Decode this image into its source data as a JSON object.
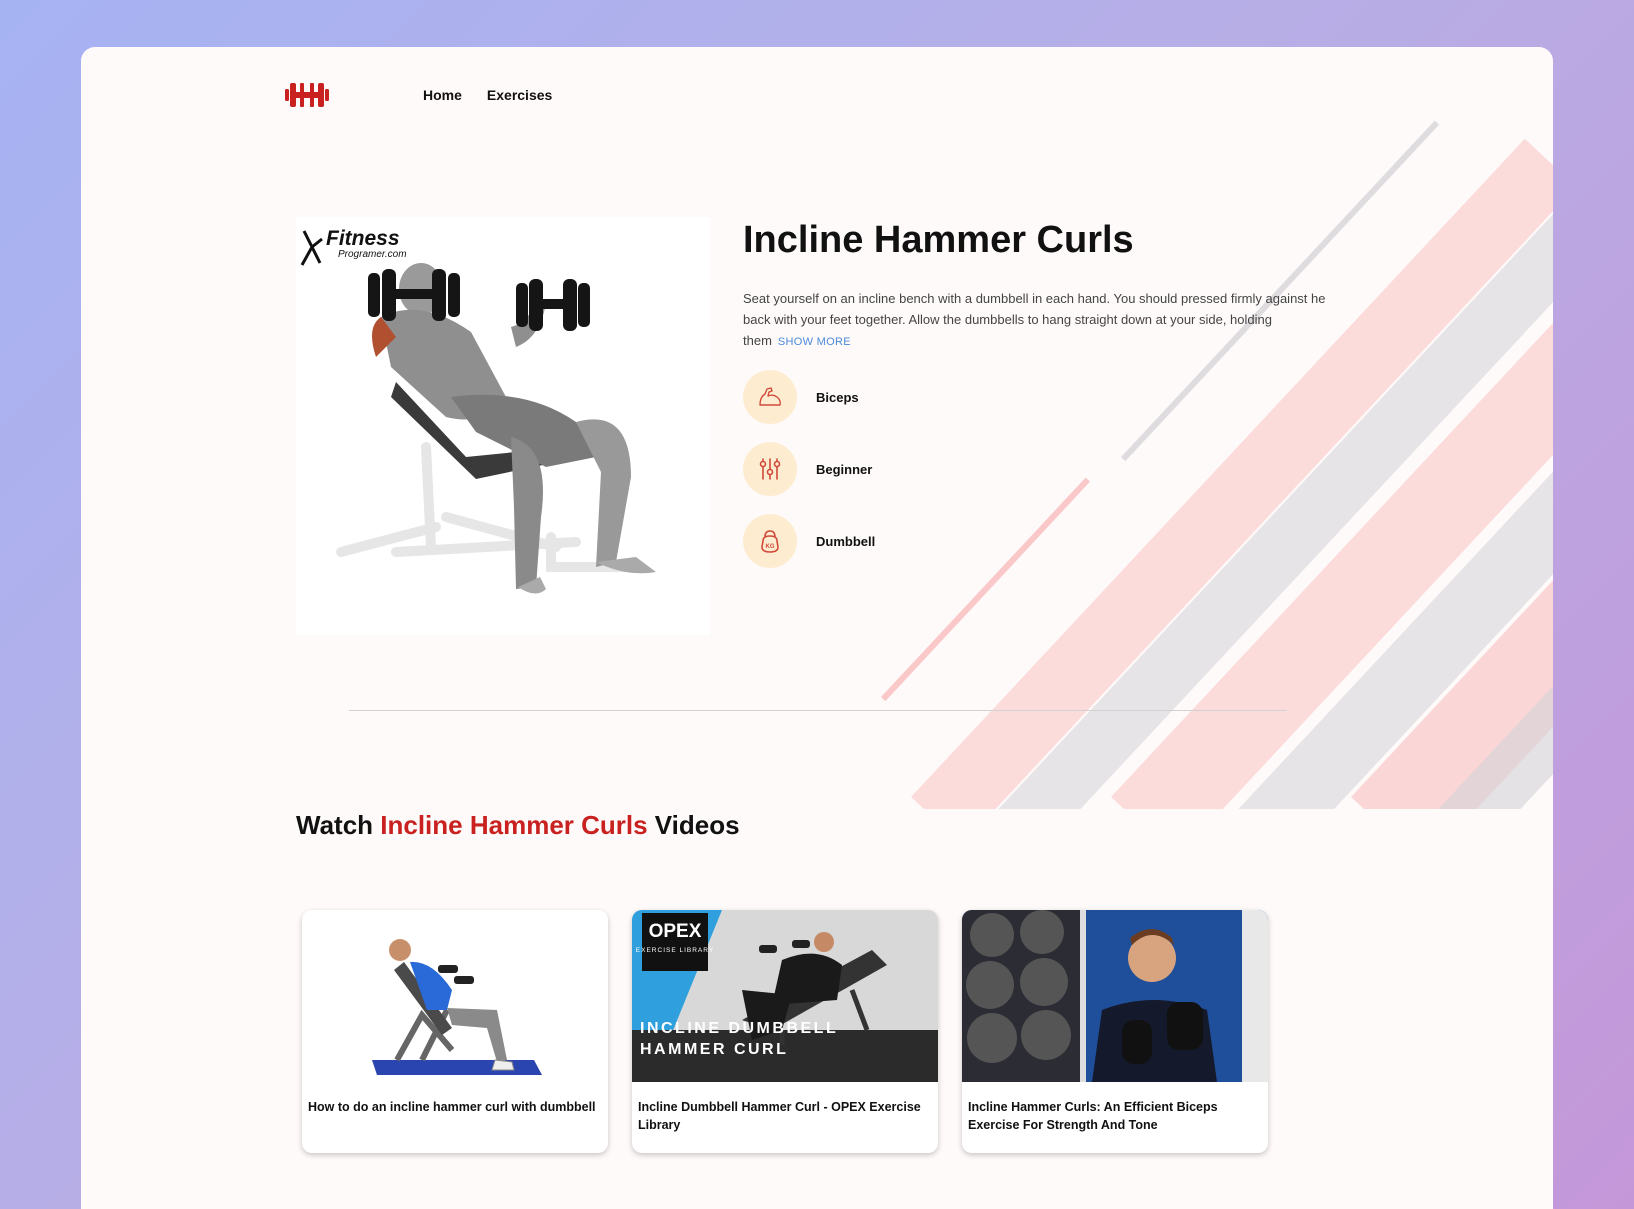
{
  "nav": {
    "logo_icon": "dumbbell-logo-icon",
    "links": [
      "Home",
      "Exercises"
    ]
  },
  "exercise": {
    "image_watermark": "Fitness Programer.com",
    "title": "Incline Hammer Curls",
    "description": "Seat yourself on an incline bench with a dumbbell in each hand. You should pressed firmly against he back with your feet together. Allow the dumbbells to hang straight down at your side, holding them",
    "show_more": "SHOW MORE",
    "tags": [
      {
        "label": "Biceps",
        "icon": "biceps-icon"
      },
      {
        "label": "Beginner",
        "icon": "sliders-icon"
      },
      {
        "label": "Dumbbell",
        "icon": "kettlebell-icon"
      }
    ]
  },
  "videos": {
    "title_prefix": "Watch ",
    "title_accent": "Incline Hammer Curls",
    "title_suffix": " Videos",
    "items": [
      {
        "title": "How to do an incline hammer curl with dumbbell"
      },
      {
        "title": "Incline Dumbbell Hammer Curl - OPEX Exercise Library",
        "badge_top": "OPEX",
        "badge_sub": "EXERCISE LIBRARY",
        "overlay": "INCLINE DUMBBELL HAMMER CURL"
      },
      {
        "title": "Incline Hammer Curls: An Efficient Biceps Exercise For Strength And Tone"
      }
    ]
  },
  "colors": {
    "accent": "#c8211f",
    "tag_bg": "#fdecd0",
    "link": "#4a8ad8"
  }
}
